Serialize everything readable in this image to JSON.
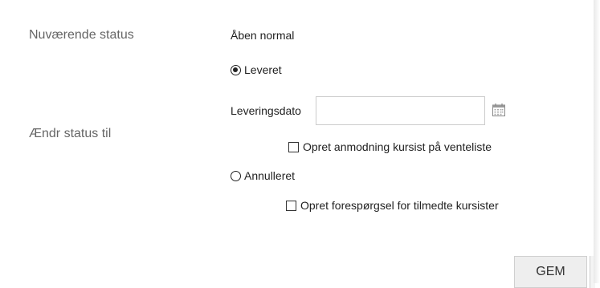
{
  "current_status": {
    "label": "Nuværende status",
    "value": "Åben normal"
  },
  "change_status": {
    "label": "Ændr status til",
    "options": [
      {
        "label": "Leveret",
        "selected": true,
        "date_label": "Leveringsdato",
        "date_value": "",
        "checkbox_label": "Opret anmodning kursist på venteliste",
        "checkbox_checked": false
      },
      {
        "label": "Annulleret",
        "selected": false,
        "checkbox_label": "Opret forespørgsel for tilmedte kursister",
        "checkbox_checked": false
      }
    ]
  },
  "actions": {
    "save_label": "GEM"
  },
  "icons": {
    "date_picker": "calendar-icon"
  }
}
